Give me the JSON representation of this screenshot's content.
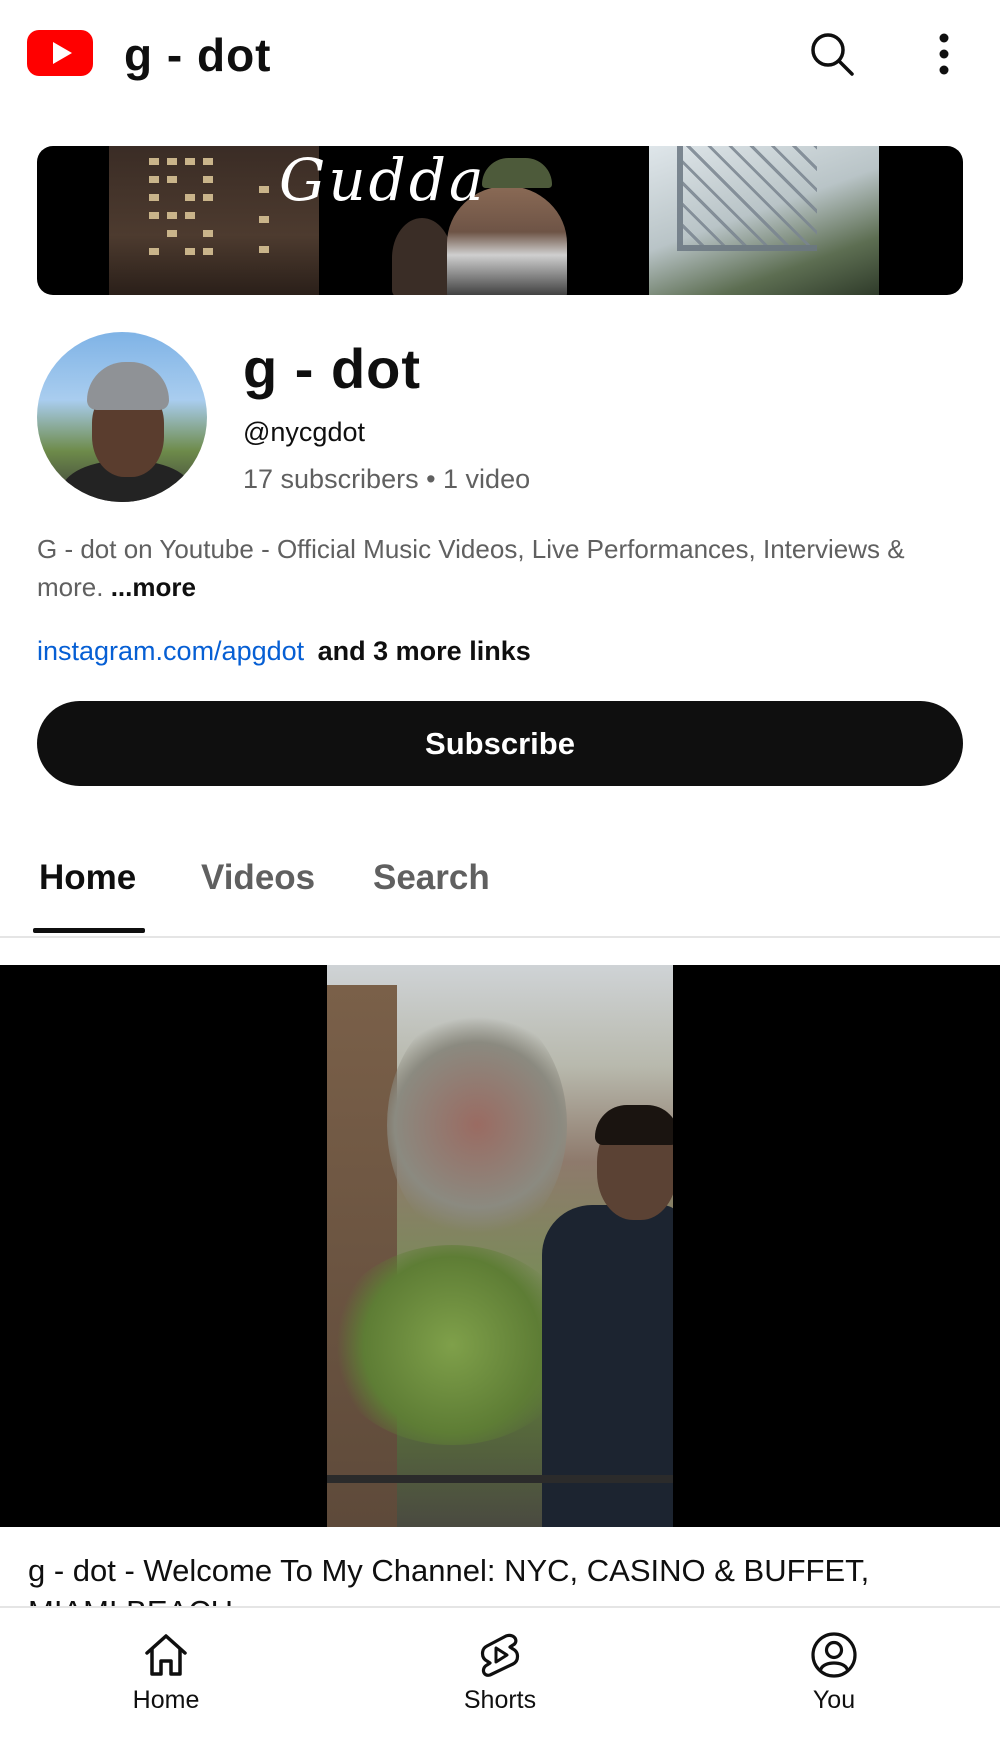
{
  "topbar": {
    "title": "g - dot",
    "logo_icon": "youtube-logo-icon",
    "search_icon": "search-icon",
    "more_icon": "more-vert-icon",
    "brand_color": "#ff0000"
  },
  "banner": {
    "text": "Gudda"
  },
  "channel": {
    "name": "g - dot",
    "handle": "@nycgdot",
    "stats": "17 subscribers • 1 video",
    "description": "G - dot on Youtube - Official Music Videos, Live Performances, Interviews & more.",
    "more_label": "...more",
    "link": "instagram.com/apgdot",
    "more_links": "and 3 more links",
    "link_color": "#065fd4"
  },
  "subscribe": {
    "label": "Subscribe"
  },
  "tabs": [
    {
      "label": "Home",
      "active": true
    },
    {
      "label": "Videos",
      "active": false
    },
    {
      "label": "Search",
      "active": false
    }
  ],
  "featured_video": {
    "title": "g - dot - Welcome To My Channel: NYC, CASINO & BUFFET,",
    "title_line2": "MIAMI BEACH"
  },
  "bottom_nav": [
    {
      "label": "Home",
      "icon": "home-icon"
    },
    {
      "label": "Shorts",
      "icon": "shorts-icon"
    },
    {
      "label": "You",
      "icon": "account-circle-icon"
    }
  ]
}
